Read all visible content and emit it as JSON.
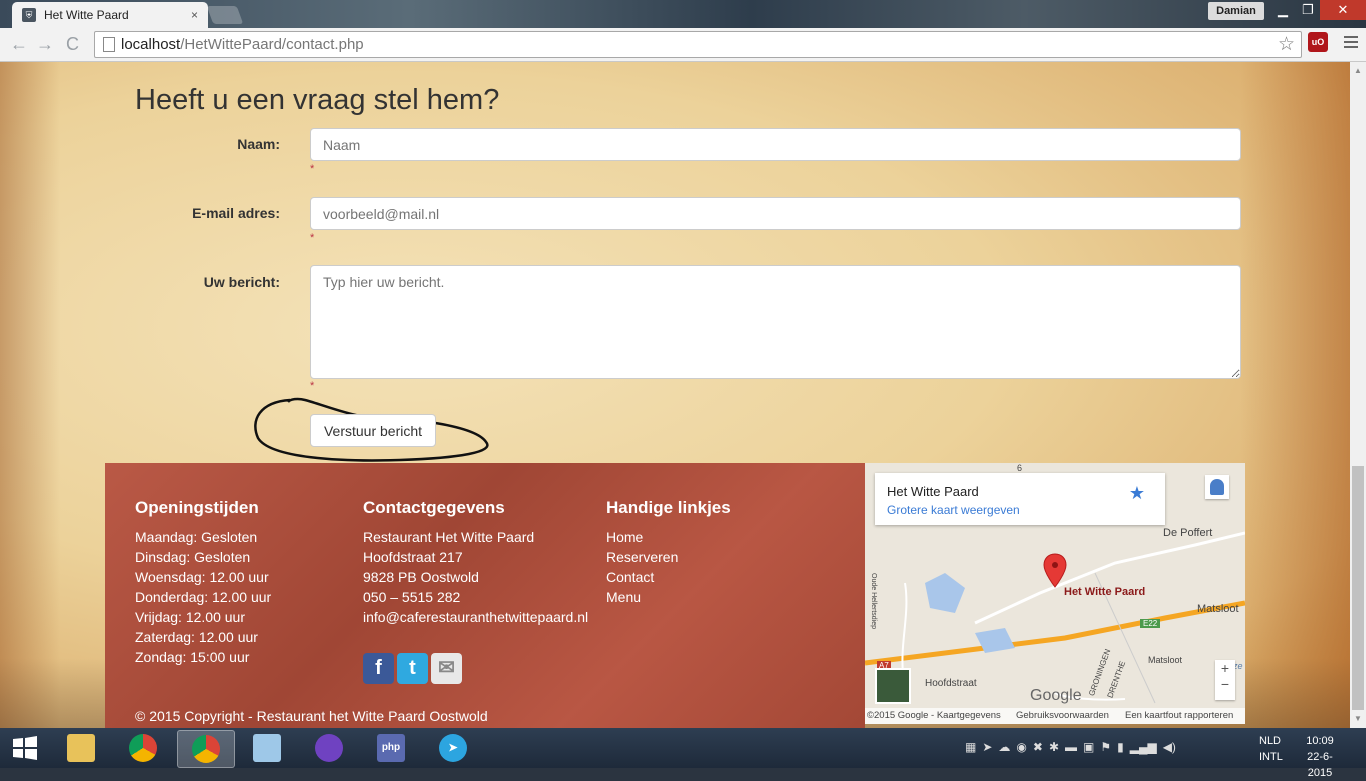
{
  "browser": {
    "tab_title": "Het Witte Paard",
    "tab_close": "×",
    "user": "Damian",
    "url_host": "localhost",
    "url_path": "/HetWittePaard/contact.php",
    "star": "☆",
    "extension_label": "uO",
    "nav_back": "←",
    "nav_forward": "→",
    "nav_reload": "C",
    "minimize": "▁",
    "restore": "❐",
    "close": "✕"
  },
  "form": {
    "heading": "Heeft u een vraag stel hem?",
    "name_label": "Naam:",
    "name_placeholder": "Naam",
    "email_label": "E-mail adres:",
    "email_placeholder": "voorbeeld@mail.nl",
    "message_label": "Uw bericht:",
    "message_placeholder": "Typ hier uw bericht.",
    "required_mark": "*",
    "submit_label": "Verstuur bericht"
  },
  "footer": {
    "hours": {
      "title": "Openingstijden",
      "lines": [
        "Maandag: Gesloten",
        "Dinsdag: Gesloten",
        "Woensdag: 12.00 uur",
        "Donderdag: 12.00 uur",
        "Vrijdag: 12.00 uur",
        "Zaterdag: 12.00 uur",
        "Zondag: 15:00 uur"
      ]
    },
    "contact": {
      "title": "Contactgegevens",
      "lines": [
        "Restaurant Het Witte Paard",
        "Hoofdstraat 217",
        "9828 PB Oostwold",
        "050 – 5515 282",
        "info@caferestauranthetwittepaard.nl"
      ]
    },
    "links": {
      "title": "Handige linkjes",
      "items": [
        "Home",
        "Reserveren",
        "Contact",
        "Menu"
      ]
    },
    "social": {
      "facebook": "f",
      "twitter": "t",
      "mail": "✉"
    },
    "copyright": "© 2015 Copyright - Restaurant het Witte Paard Oostwold"
  },
  "map": {
    "place_name": "Het Witte Paard",
    "larger_map": "Grotere kaart weergeven",
    "marker_label": "Het Witte Paard",
    "labels": [
      "De Poffert",
      "Matsloot",
      "Hoofdstraat",
      "Matsloot",
      "GRONINGEN",
      "DRENTHE",
      "E22",
      "Oude Hellertsdiep",
      "A7",
      "E22",
      "Peize",
      "6"
    ],
    "zoom_in": "+",
    "zoom_out": "−",
    "logo": "Google",
    "attr_copyright": "©2015 Google - Kaartgegevens",
    "attr_terms": "Gebruiksvoorwaarden",
    "attr_report": "Een kaartfout rapporteren"
  },
  "taskbar": {
    "apps": [
      "Windows",
      "Verkenner",
      "Chrome",
      "Chrome",
      "Notepad",
      "GitHub",
      "PhpStorm",
      "Telegram"
    ],
    "lang": "NLD",
    "lang2": "INTL",
    "time": "10:09",
    "date": "22-6-2015"
  }
}
